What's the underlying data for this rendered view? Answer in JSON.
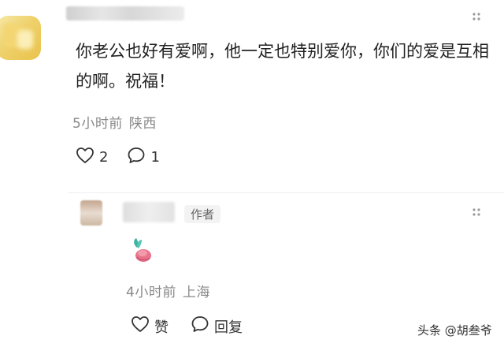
{
  "comment": {
    "text": "你老公也好有爱啊，他一定也特别爱你，你们的爱是互相的啊。祝福！",
    "time": "5小时前",
    "location": "陕西",
    "like_count": "2",
    "reply_count": "1"
  },
  "reply": {
    "author_badge": "作者",
    "time": "4小时前",
    "location": "上海",
    "like_label": "赞",
    "reply_label": "回复"
  },
  "watermark": "头条 @胡叁爷",
  "colors": {
    "text": "#222222",
    "meta": "#888888",
    "icon": "#333333"
  }
}
